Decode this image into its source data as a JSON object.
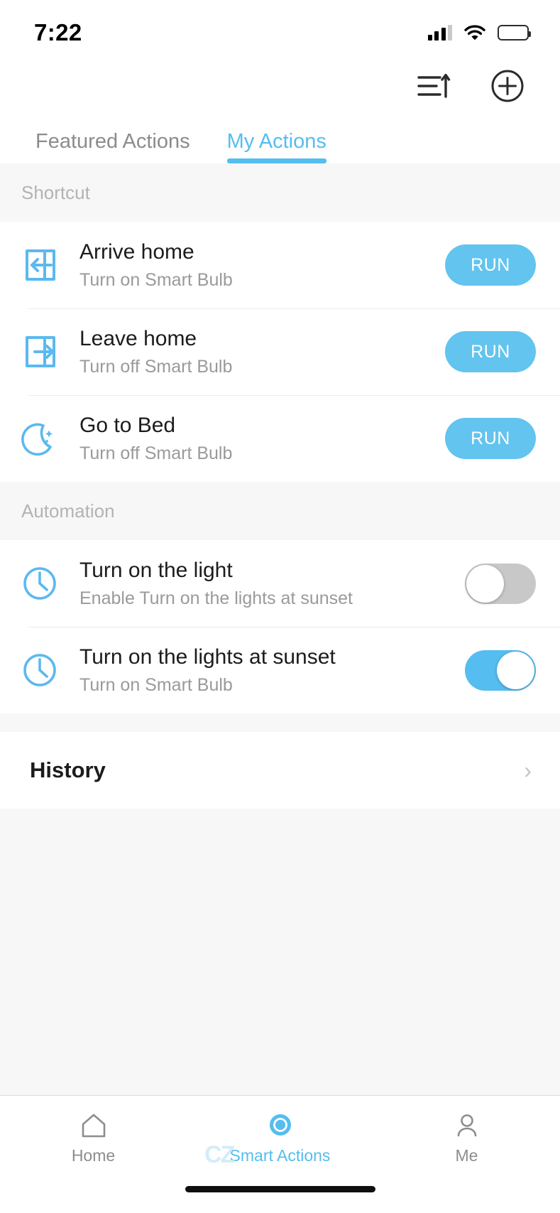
{
  "status_bar": {
    "time": "7:22",
    "signal_icon": "cellular-signal-icon",
    "wifi_icon": "wifi-icon",
    "battery_icon": "battery-full-icon"
  },
  "app_bar": {
    "sort_icon": "sort-list-icon",
    "add_icon": "add-circle-icon"
  },
  "tabs": [
    {
      "label": "Featured Actions",
      "active": false
    },
    {
      "label": "My Actions",
      "active": true
    }
  ],
  "sections": [
    {
      "header": "Shortcut",
      "rows": [
        {
          "icon": "login-arrow-icon",
          "title": "Arrive home",
          "subtitle": "Turn on Smart Bulb",
          "control": "run",
          "run_label": "RUN"
        },
        {
          "icon": "logout-arrow-icon",
          "title": "Leave home",
          "subtitle": "Turn off Smart Bulb",
          "control": "run",
          "run_label": "RUN"
        },
        {
          "icon": "moon-star-icon",
          "title": "Go to Bed",
          "subtitle": "Turn off Smart Bulb",
          "control": "run",
          "run_label": "RUN"
        }
      ]
    },
    {
      "header": "Automation",
      "rows": [
        {
          "icon": "clock-icon",
          "title": "Turn on the light",
          "subtitle": "Enable Turn on the lights at sunset",
          "control": "toggle",
          "toggle_on": false
        },
        {
          "icon": "clock-icon",
          "title": "Turn on the lights at sunset",
          "subtitle": "Turn on Smart Bulb",
          "control": "toggle",
          "toggle_on": true
        }
      ]
    }
  ],
  "history": {
    "label": "History",
    "chevron_icon": "chevron-right-icon",
    "chevron_glyph": "›"
  },
  "bottom_nav": {
    "watermark": "CZ",
    "items": [
      {
        "label": "Home",
        "icon": "home-icon",
        "active": false
      },
      {
        "label": "Smart Actions",
        "icon": "smart-actions-circle-icon",
        "active": true
      },
      {
        "label": "Me",
        "icon": "person-icon",
        "active": false
      }
    ]
  },
  "colors": {
    "accent": "#55bdf0",
    "run_button": "#62c4ef",
    "toggle_off": "#c8c8c8",
    "muted_text": "#9a9a9a",
    "section_bg": "#f7f7f7"
  }
}
